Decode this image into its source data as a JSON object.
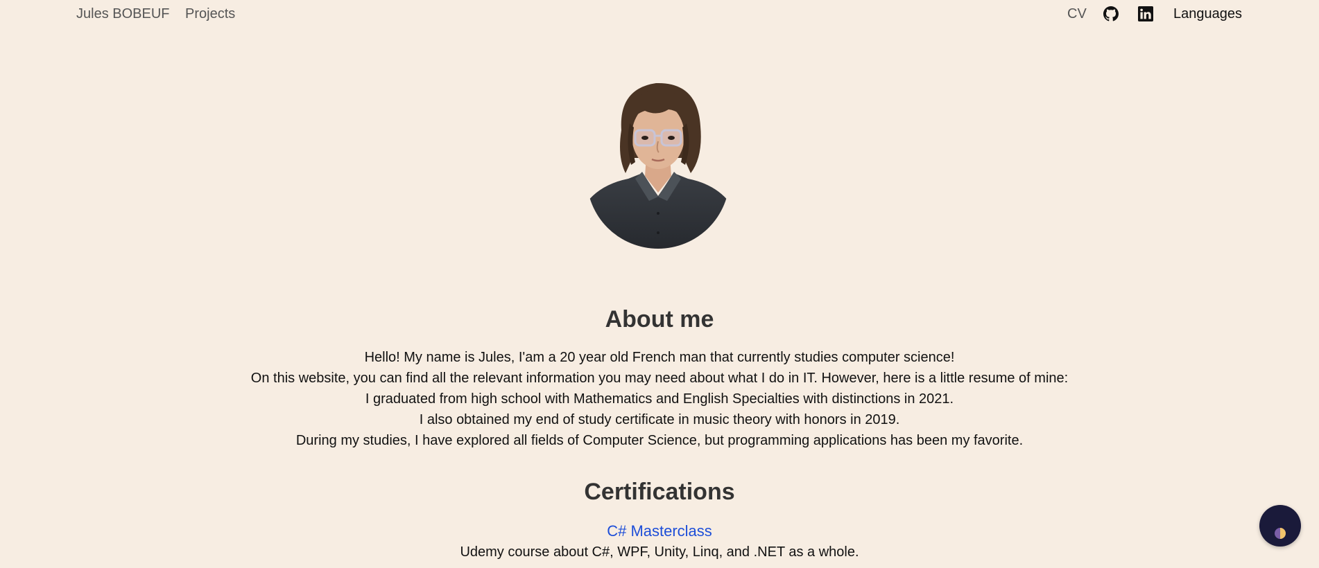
{
  "navbar": {
    "brand": "Jules BOBEUF",
    "projects": "Projects",
    "cv": "CV",
    "github_icon": "github-icon",
    "linkedin_icon": "linkedin-icon",
    "languages": "Languages"
  },
  "about": {
    "heading": "About me",
    "lines": [
      "Hello! My name is Jules, I'am a 20 year old French man that currently studies computer science!",
      "On this website, you can find all the relevant information you may need about what I do in IT. However, here is a little resume of mine:",
      "I graduated from high school with Mathematics and English Specialties with distinctions in 2021.",
      "I also obtained my end of study certificate in music theory with honors in 2019.",
      "During my studies, I have explored all fields of Computer Science, but programming applications has been my favorite."
    ]
  },
  "certifications": {
    "heading": "Certifications",
    "items": [
      {
        "title": "C# Masterclass",
        "description": "Udemy course about C#, WPF, Unity, Linq, and .NET as a whole."
      }
    ]
  },
  "theme_toggle": {
    "icon": "half-moon-icon"
  },
  "colors": {
    "background": "#f7ede2",
    "link": "#1d4ed8",
    "heading": "#333333",
    "toggle_bg": "#1a1a3a"
  }
}
